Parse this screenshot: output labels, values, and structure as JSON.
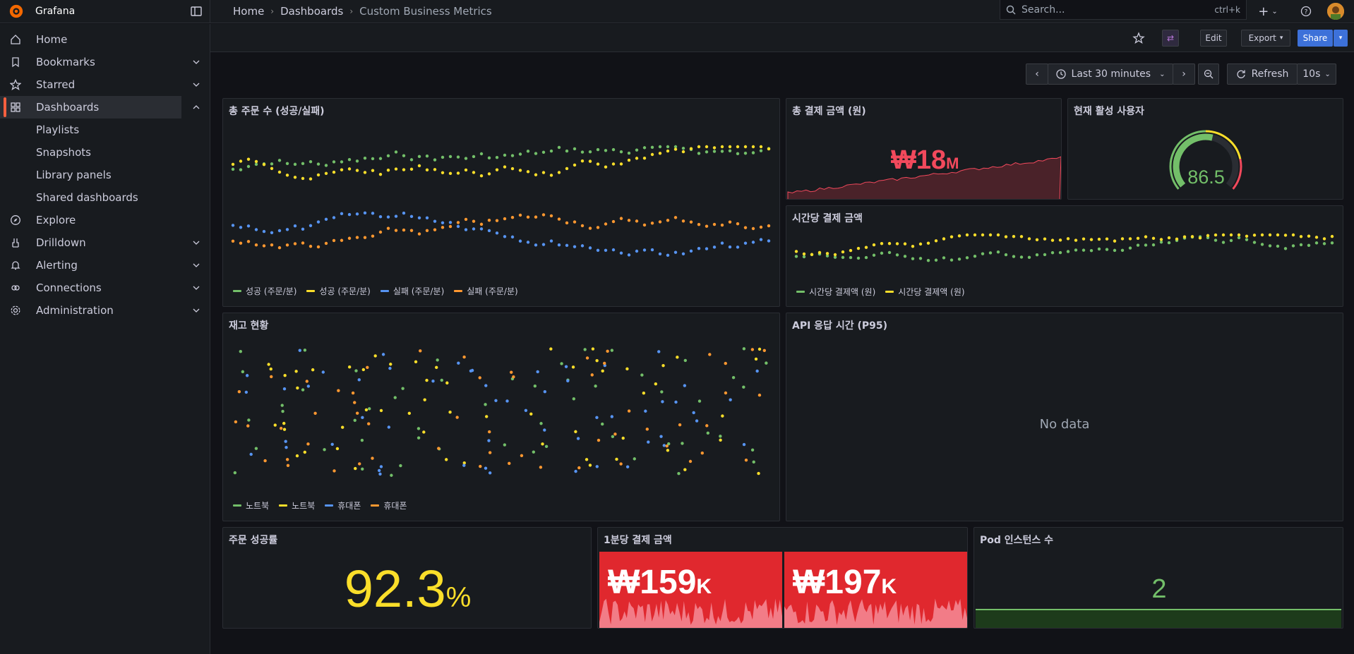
{
  "app": {
    "name": "Grafana"
  },
  "breadcrumb": [
    "Home",
    "Dashboards",
    "Custom Business Metrics"
  ],
  "search": {
    "placeholder": "Search...",
    "shortcut": "ctrl+k"
  },
  "toolbar": {
    "edit": "Edit",
    "export": "Export",
    "share": "Share"
  },
  "nav": {
    "items": [
      {
        "label": "Home",
        "icon": "home-icon",
        "chevron": ""
      },
      {
        "label": "Bookmarks",
        "icon": "bookmark-icon",
        "chevron": "down"
      },
      {
        "label": "Starred",
        "icon": "star-icon",
        "chevron": "down"
      },
      {
        "label": "Dashboards",
        "icon": "apps-icon",
        "chevron": "up",
        "active": true
      }
    ],
    "sub": [
      "Playlists",
      "Snapshots",
      "Library panels",
      "Shared dashboards"
    ],
    "items2": [
      {
        "label": "Explore",
        "icon": "compass-icon",
        "chevron": ""
      },
      {
        "label": "Drilldown",
        "icon": "drilldown-icon",
        "chevron": "down"
      },
      {
        "label": "Alerting",
        "icon": "bell-icon",
        "chevron": "down"
      },
      {
        "label": "Connections",
        "icon": "link-icon",
        "chevron": "down"
      },
      {
        "label": "Administration",
        "icon": "cog-icon",
        "chevron": "down"
      }
    ]
  },
  "timerange": {
    "label": "Last 30 minutes",
    "refresh": "Refresh",
    "interval": "10s"
  },
  "panels": {
    "orders": {
      "title": "총 주문 수 (성공/실패)",
      "legend": [
        "성공 (주문/분)",
        "성공 (주문/분)",
        "실패 (주문/분)",
        "실패 (주문/분)"
      ]
    },
    "total_payment": {
      "title": "총 결제 금액 (원)",
      "value": "₩18",
      "unit": "M"
    },
    "active_users": {
      "title": "현재 활성 사용자",
      "value": "86.5",
      "gauge_fraction": 0.55
    },
    "hourly": {
      "title": "시간당 결제 금액",
      "legend": [
        "시간당 결제액 (원)",
        "시간당 결제액 (원)"
      ]
    },
    "inventory": {
      "title": "재고 현황",
      "legend": [
        "노트북",
        "노트북",
        "휴대폰",
        "휴대폰"
      ]
    },
    "api": {
      "title": "API 응답 시간 (P95)",
      "nodata": "No data"
    },
    "success_rate": {
      "title": "주문 성공률",
      "value": "92.3",
      "unit": "%"
    },
    "per_minute": {
      "title": "1분당 결제 금액",
      "values": [
        {
          "value": "₩159",
          "unit": "K"
        },
        {
          "value": "₩197",
          "unit": "K"
        }
      ]
    },
    "pods": {
      "title": "Pod 인스턴스 수",
      "value": "2"
    }
  },
  "colors": {
    "green": "#73bf69",
    "yellow": "#fade2a",
    "blue": "#5794f2",
    "orange": "#ff9830",
    "red": "#f2495c"
  }
}
